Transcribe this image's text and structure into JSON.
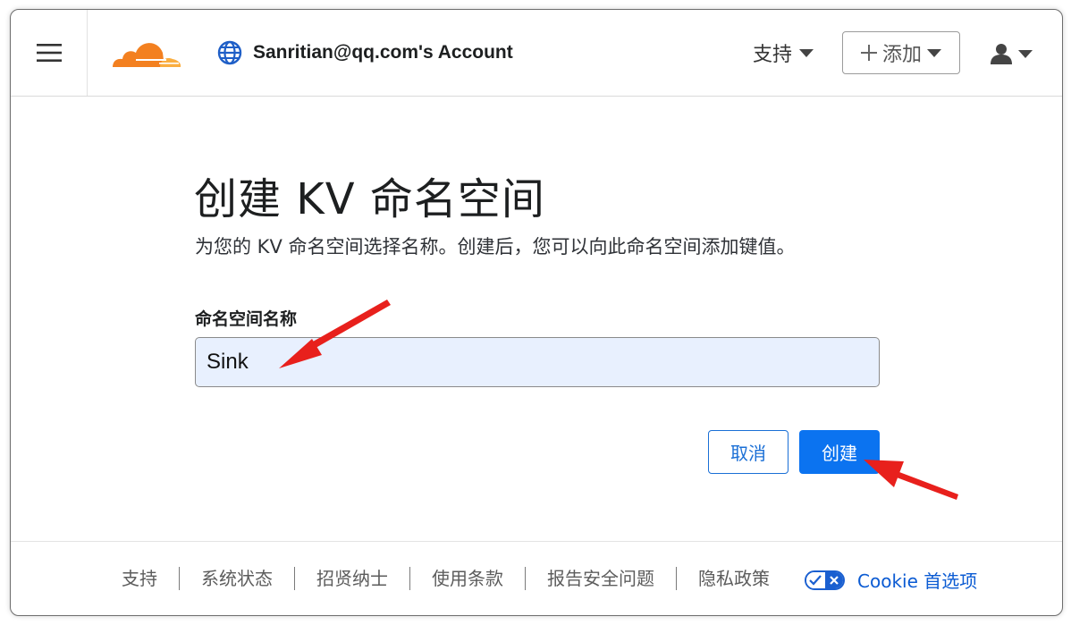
{
  "header": {
    "account_name": "Sanritian@qq.com's Account",
    "support_label": "支持",
    "add_label": "添加"
  },
  "main": {
    "title": "创建 KV 命名空间",
    "subtitle": "为您的 KV 命名空间选择名称。创建后，您可以向此命名空间添加键值。",
    "field_label": "命名空间名称",
    "field_value": "Sink",
    "cancel_label": "取消",
    "create_label": "创建"
  },
  "footer": {
    "links": [
      "支持",
      "系统状态",
      "招贤纳士",
      "使用条款",
      "报告安全问题",
      "隐私政策"
    ],
    "cookie_label": "Cookie 首选项"
  },
  "colors": {
    "brand_orange": "#f38020",
    "primary_blue": "#0b73f0",
    "input_bg": "#e8f0fe",
    "annotation_red": "#e8201c"
  },
  "icons": [
    "menu-icon",
    "cloudflare-logo",
    "globe-icon",
    "chevron-down-icon",
    "plus-icon",
    "user-icon",
    "privacy-toggle-icon"
  ]
}
